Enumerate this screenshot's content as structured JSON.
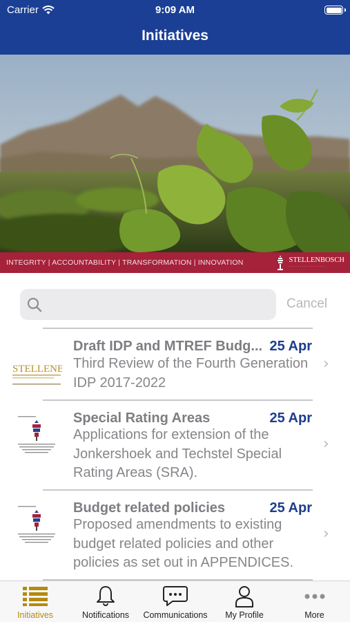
{
  "status_bar": {
    "carrier": "Carrier",
    "time": "9:09 AM"
  },
  "header": {
    "title": "Initiatives"
  },
  "banner": {
    "tagline": "INTEGRITY | ACCOUNTABILITY | TRANSFORMATION | INNOVATION",
    "logo_text": "STELLENBOSCH",
    "strip_color": "#a6213a"
  },
  "search": {
    "placeholder": "",
    "cancel_label": "Cancel"
  },
  "items": [
    {
      "title": "Draft IDP and MTREF Budg...",
      "date": "25 Apr",
      "description": "Third Review of the Fourth Generation IDP 2017-2022",
      "thumb_icon": "stellenbosch-document-icon"
    },
    {
      "title": "Special Rating Areas",
      "date": "25 Apr",
      "description": "Applications for extension of the Jonkershoek and Techstel Special Rating Areas (SRA).",
      "thumb_icon": "municipal-crest-document-icon"
    },
    {
      "title": "Budget related policies",
      "date": "25 Apr",
      "description": "Proposed amendments to existing budget related policies and other policies as set out in APPENDICES.",
      "thumb_icon": "municipal-crest-document-icon"
    }
  ],
  "tabs": [
    {
      "label": "Initiatives",
      "icon": "list-icon",
      "active": true
    },
    {
      "label": "Notifications",
      "icon": "bell-icon",
      "active": false
    },
    {
      "label": "Communications",
      "icon": "chat-bubble-icon",
      "active": false
    },
    {
      "label": "My Profile",
      "icon": "person-icon",
      "active": false
    },
    {
      "label": "More",
      "icon": "ellipsis-icon",
      "active": false
    }
  ],
  "colors": {
    "header": "#1b3f94",
    "accent": "#b58a10",
    "date": "#1d3d8c"
  }
}
